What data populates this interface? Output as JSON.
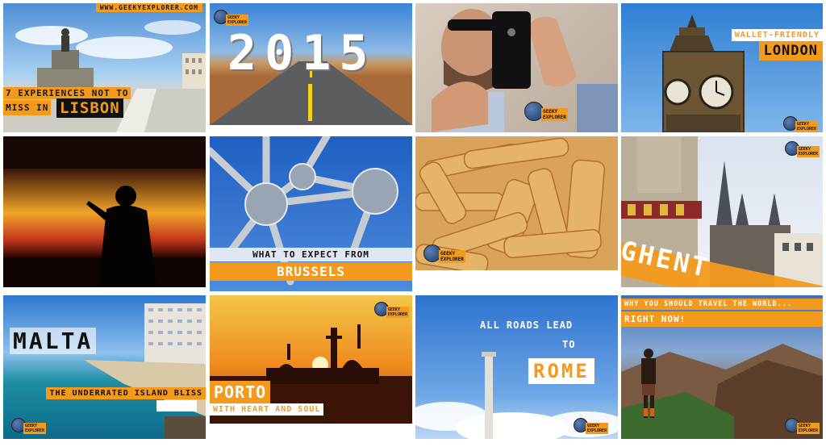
{
  "site_url": "WWW.GEEKYEXPLORER.COM",
  "logo_text": [
    "GEEKY",
    "EXPLORER"
  ],
  "tiles": {
    "lisbon": {
      "line1": "7 EXPERIENCES NOT TO",
      "line2": "MISS IN",
      "highlight": "LISBON"
    },
    "year": {
      "title": "2015"
    },
    "london": {
      "line1": "WALLET-FRIENDLY",
      "highlight": "LONDON"
    },
    "brussels": {
      "line1": "WHAT TO EXPECT FROM",
      "highlight": "BRUSSELS"
    },
    "ghent": {
      "highlight": "GHENT"
    },
    "malta": {
      "title": "MALTA",
      "subtitle": "THE UNDERRATED ISLAND BLISS"
    },
    "porto": {
      "highlight": "PORTO",
      "subtitle": "WITH HEART AND SOUL"
    },
    "rome": {
      "line1": "ALL ROADS LEAD",
      "line2": "TO",
      "highlight": "ROME"
    },
    "travel": {
      "line1": "WHY YOU SHOULD TRAVEL THE WORLD...",
      "line2": "RIGHT NOW!"
    }
  },
  "colors": {
    "accent": "#f39a1c",
    "dark": "#111111"
  }
}
